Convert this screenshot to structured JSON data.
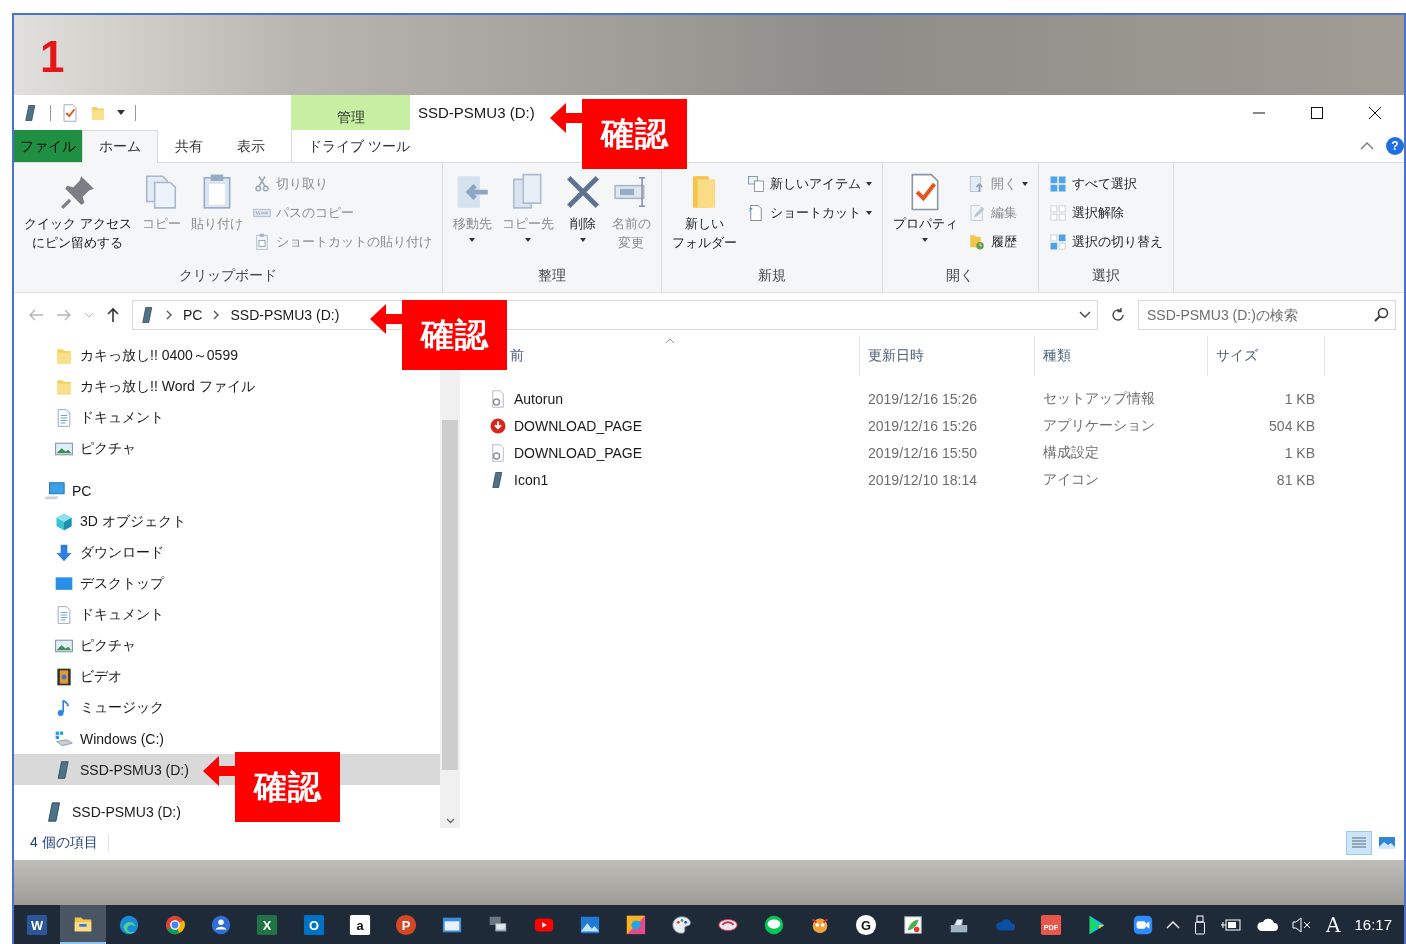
{
  "annotation_number": "1",
  "title_bar": {
    "title": "SSD-PSMU3 (D:)",
    "context_header": "管理"
  },
  "tabs": [
    {
      "label": "ファイル",
      "kind": "file",
      "selected": false
    },
    {
      "label": "ホーム",
      "kind": "normal",
      "selected": true
    },
    {
      "label": "共有",
      "kind": "normal",
      "selected": false
    },
    {
      "label": "表示",
      "kind": "normal",
      "selected": false
    }
  ],
  "context_tabs": [
    {
      "label": "ドライブ ツール",
      "selected": false
    }
  ],
  "help_button": "?",
  "ribbon_groups": [
    {
      "label": "クリップボード",
      "columns": [
        [
          {
            "kind": "pin",
            "label_lines": [
              "クイック アクセス",
              "にピン留めする"
            ],
            "disabled": false,
            "dropdown": false
          }
        ],
        [
          {
            "kind": "copy",
            "label": "コピー",
            "disabled": true,
            "dropdown": false
          }
        ],
        [
          {
            "kind": "paste",
            "label": "貼り付け",
            "disabled": true,
            "dropdown": false
          }
        ],
        [
          {
            "kind": "cut",
            "label": "切り取り",
            "disabled": true,
            "dropdown": false
          },
          {
            "kind": "path",
            "label": "パスのコピー",
            "disabled": true,
            "dropdown": false
          },
          {
            "kind": "paste-shortcut",
            "label": "ショートカットの貼り付け",
            "disabled": true,
            "dropdown": false
          }
        ]
      ]
    },
    {
      "label": "整理",
      "columns": [
        [
          {
            "kind": "move",
            "label": "移動先",
            "disabled": true,
            "dropdown": true
          }
        ],
        [
          {
            "kind": "copy-to",
            "label": "コピー先",
            "disabled": true,
            "dropdown": true
          }
        ],
        [
          {
            "kind": "delete",
            "label": "削除",
            "disabled": false,
            "dropdown": true
          }
        ],
        [
          {
            "kind": "rename",
            "label_lines": [
              "名前の",
              "変更"
            ],
            "disabled": true,
            "dropdown": false
          }
        ]
      ]
    },
    {
      "label": "新規",
      "columns": [
        [
          {
            "kind": "new-folder",
            "label_lines": [
              "新しい",
              "フォルダー"
            ],
            "disabled": false,
            "dropdown": false
          }
        ],
        [
          {
            "kind": "new-item",
            "label": "新しいアイテム",
            "disabled": false,
            "dropdown": true
          },
          {
            "kind": "shortcut",
            "label": "ショートカット",
            "disabled": false,
            "dropdown": true
          }
        ]
      ]
    },
    {
      "label": "開く",
      "columns": [
        [
          {
            "kind": "properties",
            "label": "プロパティ",
            "disabled": false,
            "dropdown": true
          }
        ],
        [
          {
            "kind": "open",
            "label": "開く",
            "disabled": true,
            "dropdown": true
          },
          {
            "kind": "edit",
            "label": "編集",
            "disabled": true,
            "dropdown": false
          },
          {
            "kind": "history",
            "label": "履歴",
            "disabled": false,
            "dropdown": false
          }
        ]
      ]
    },
    {
      "label": "選択",
      "columns": [
        [
          {
            "kind": "select-all",
            "label": "すべて選択",
            "disabled": false,
            "dropdown": false
          },
          {
            "kind": "select-none",
            "label": "選択解除",
            "disabled": false,
            "dropdown": false
          },
          {
            "kind": "invert",
            "label": "選択の切り替え",
            "disabled": false,
            "dropdown": false
          }
        ]
      ]
    }
  ],
  "address": {
    "path": [
      "PC",
      "SSD-PSMU3 (D:)"
    ]
  },
  "search": {
    "placeholder": "SSD-PSMU3 (D:)の検索"
  },
  "quick_access_items": [
    {
      "label": "カキっ放し!! 0400～0599",
      "kind": "folder",
      "selected": false
    },
    {
      "label": "カキっ放し!! Word ファイル",
      "kind": "folder",
      "selected": false
    },
    {
      "label": "ドキュメント",
      "kind": "documents",
      "selected": false
    },
    {
      "label": "ピクチャ",
      "kind": "pictures",
      "selected": false
    }
  ],
  "nav_tree": [
    {
      "label": "PC",
      "kind": "pc",
      "selected": false,
      "children": [
        {
          "label": "3D オブジェクト",
          "kind": "cube",
          "selected": false
        },
        {
          "label": "ダウンロード",
          "kind": "downloads",
          "selected": false
        },
        {
          "label": "デスクトップ",
          "kind": "desktop",
          "selected": false
        },
        {
          "label": "ドキュメント",
          "kind": "documents",
          "selected": false
        },
        {
          "label": "ピクチャ",
          "kind": "pictures",
          "selected": false
        },
        {
          "label": "ビデオ",
          "kind": "videos",
          "selected": false
        },
        {
          "label": "ミュージック",
          "kind": "music",
          "selected": false
        },
        {
          "label": "Windows (C:)",
          "kind": "system-drive",
          "selected": false
        },
        {
          "label": "SSD-PSMU3 (D:)",
          "kind": "drive",
          "selected": true
        }
      ]
    },
    {
      "label": "SSD-PSMU3 (D:)",
      "kind": "drive",
      "selected": false
    }
  ],
  "file_columns": [
    "前",
    "更新日時",
    "種類",
    "サイズ"
  ],
  "files": [
    {
      "kind": "setup",
      "name": "Autorun",
      "modified": "2019/12/16 15:26",
      "type": "セットアップ情報",
      "size": "1 KB"
    },
    {
      "kind": "app-download",
      "name": "DOWNLOAD_PAGE",
      "modified": "2019/12/16 15:26",
      "type": "アプリケーション",
      "size": "504 KB"
    },
    {
      "kind": "setup",
      "name": "DOWNLOAD_PAGE",
      "modified": "2019/12/16 15:50",
      "type": "構成設定",
      "size": "1 KB"
    },
    {
      "kind": "drive",
      "name": "Icon1",
      "modified": "2019/12/10 18:14",
      "type": "アイコン",
      "size": "81 KB"
    }
  ],
  "status_bar": {
    "item_count": "4 個の項目"
  },
  "views": [
    {
      "kind": "details",
      "selected": true
    },
    {
      "kind": "large-icons",
      "selected": false
    }
  ],
  "annotations": [
    {
      "text": "確認"
    },
    {
      "text": "確認"
    },
    {
      "text": "確認"
    }
  ],
  "taskbar": [
    {
      "kind": "tile",
      "color": "#2b579a",
      "letter": "W",
      "selected": false
    },
    {
      "kind": "explorer",
      "selected": true
    },
    {
      "kind": "edge",
      "selected": false
    },
    {
      "kind": "chrome",
      "selected": false
    },
    {
      "kind": "person",
      "selected": false
    },
    {
      "kind": "tile",
      "color": "#217346",
      "letter": "X",
      "selected": false
    },
    {
      "kind": "tile",
      "color": "#0072c6",
      "letter": "O",
      "selected": false
    },
    {
      "kind": "tile",
      "color": "#ffffff",
      "letter": "a",
      "selected": false
    },
    {
      "kind": "round",
      "color": "#d24726",
      "letter": "P",
      "selected": false
    },
    {
      "kind": "window",
      "selected": false
    },
    {
      "kind": "computers",
      "selected": false
    },
    {
      "kind": "play-red",
      "selected": false
    },
    {
      "kind": "photo",
      "selected": false
    },
    {
      "kind": "colors",
      "selected": false
    },
    {
      "kind": "palette",
      "selected": false
    },
    {
      "kind": "hat",
      "selected": false
    },
    {
      "kind": "chat",
      "selected": false
    },
    {
      "kind": "mascot",
      "selected": false
    },
    {
      "kind": "round",
      "color": "#ffffff",
      "letter": "G",
      "selected": false
    },
    {
      "kind": "green-app",
      "selected": false
    },
    {
      "kind": "scanner",
      "selected": false
    },
    {
      "kind": "cloud",
      "selected": false
    },
    {
      "kind": "tile",
      "color": "#e8574b",
      "letter": "PDF",
      "selected": false
    },
    {
      "kind": "play-store",
      "selected": false
    },
    {
      "kind": "camera",
      "selected": false
    }
  ],
  "tray": {
    "ime": "A",
    "time": "16:17"
  }
}
